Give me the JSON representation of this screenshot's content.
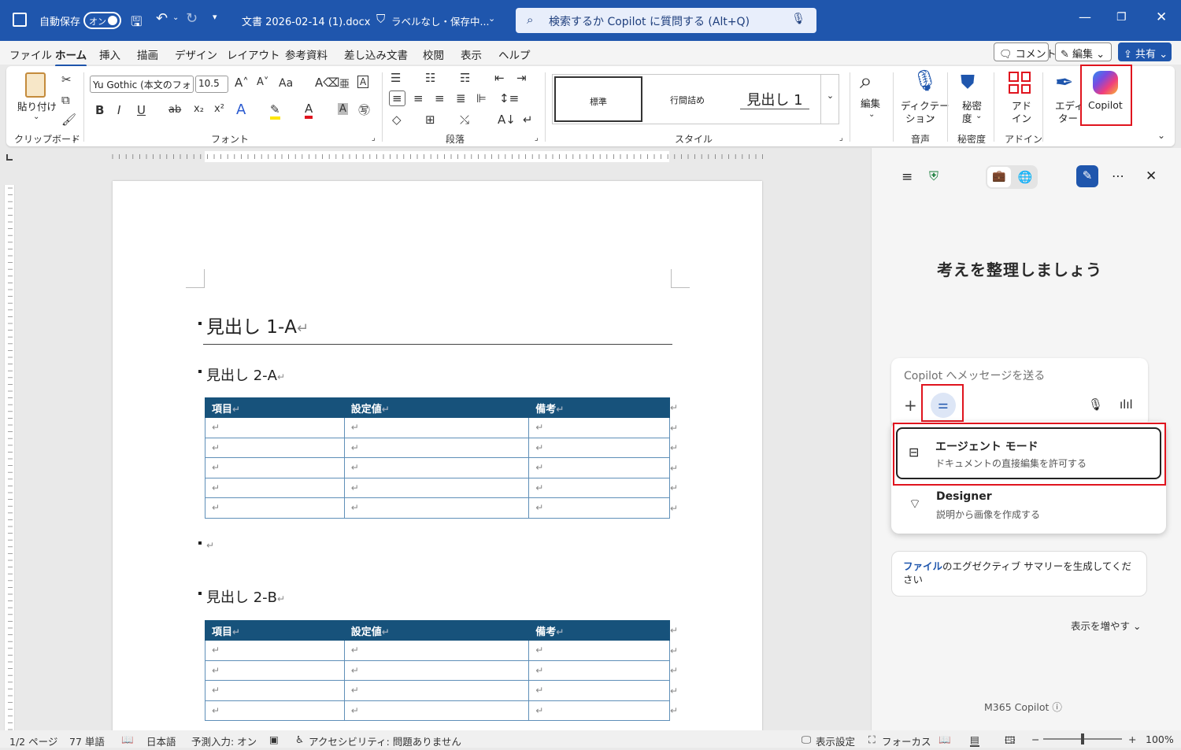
{
  "titlebar": {
    "autosave_label": "自動保存",
    "autosave_state": "オン",
    "doc_title": "文書 2026-02-14 (1).docx",
    "label_status": "ラベルなし・保存中...",
    "search_placeholder": "検索するか Copilot に質問する (Alt+Q)"
  },
  "menu": {
    "items": [
      "ファイル",
      "ホーム",
      "挿入",
      "描画",
      "デザイン",
      "レイアウト",
      "参考資料",
      "差し込み文書",
      "校閲",
      "表示",
      "ヘルプ"
    ],
    "active": "ホーム",
    "comment_btn": "コメント",
    "edit_btn": "編集",
    "share_btn": "共有"
  },
  "ribbon": {
    "paste": "貼り付け",
    "font_name": "Yu Gothic (本文のフォ",
    "font_size": "10.5",
    "case_btn": "Aa",
    "style_items": [
      "標準",
      "行間詰め",
      "見出し 1"
    ],
    "edit": "編集",
    "dictate_line1": "ディクテー",
    "dictate_line2": "ション",
    "sensitivity_line1": "秘密",
    "sensitivity_line2": "度",
    "addin_line1": "アド",
    "addin_line2": "イン",
    "editor_line1": "エディ",
    "editor_line2": "ター",
    "copilot": "Copilot",
    "groups": [
      "クリップボード",
      "フォント",
      "段落",
      "スタイル",
      "音声",
      "秘密度",
      "アドイン"
    ]
  },
  "document": {
    "heading1": "見出し 1-A",
    "heading2a": "見出し 2-A",
    "heading2b": "見出し 2-B",
    "table_headers": [
      "項目",
      "設定値",
      "備考"
    ],
    "return_mark": "↵"
  },
  "status": {
    "page": "1/2 ページ",
    "words": "77 単語",
    "language": "日本語",
    "predict": "予測入力: オン",
    "accessibility": "アクセシビリティ: 問題ありません",
    "display_settings": "表示設定",
    "focus": "フォーカス",
    "zoom": "100%"
  },
  "copilot": {
    "heading": "考えを整理しましょう",
    "input_placeholder": "Copilot へメッセージを送る",
    "agent_title": "エージェント モード",
    "agent_desc": "ドキュメントの直接編集を許可する",
    "designer_title": "Designer",
    "designer_desc": "説明から画像を作成する",
    "suggest_link": "ファイル",
    "suggest_rest": "のエグゼクティブ サマリーを生成してください",
    "more": "表示を増やす",
    "footer": "M365 Copilot"
  },
  "colors": {
    "accent": "#1f56ad",
    "table_header": "#17527b",
    "highlight": "#e0141e"
  }
}
